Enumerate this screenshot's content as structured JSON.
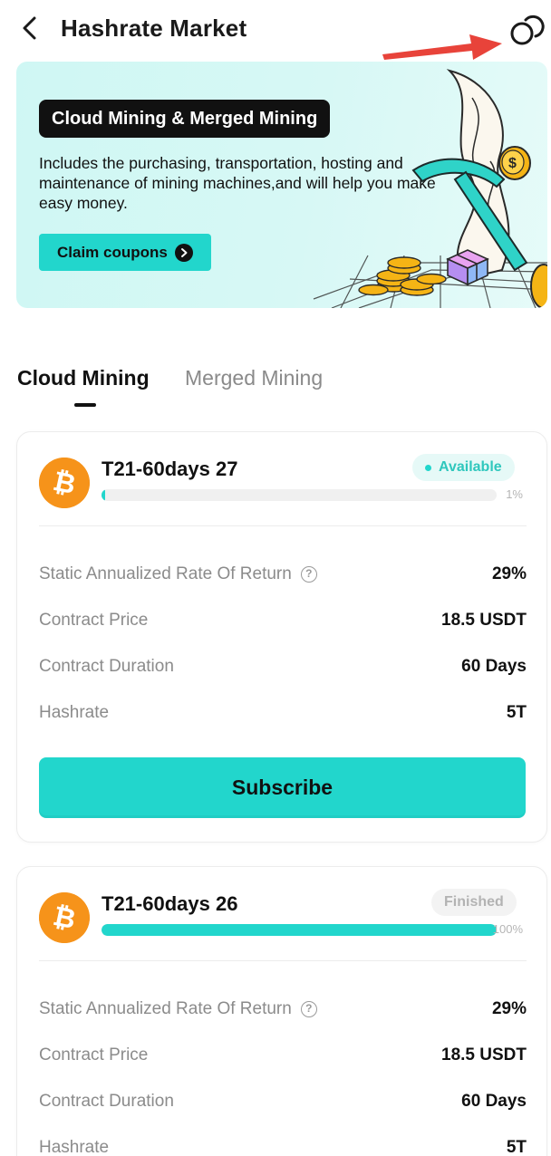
{
  "header": {
    "title": "Hashrate Market",
    "back_icon": "chevron-left-icon",
    "orders_icon": "linked-circles-icon"
  },
  "annotation": {
    "arrow_color": "#e8433a"
  },
  "banner": {
    "tag": "Cloud Mining & Merged Mining",
    "description": "Includes the purchasing, transportation, hosting and maintenance of mining machines,and will help you make easy money.",
    "claim_button": "Claim coupons",
    "background_color": "#d4f7f4"
  },
  "tabs": [
    {
      "label": "Cloud Mining",
      "active": true
    },
    {
      "label": "Merged Mining",
      "active": false
    }
  ],
  "colors": {
    "accent": "#22d6cc",
    "bitcoin": "#f6931a",
    "muted_text": "#8b8b8b"
  },
  "products": [
    {
      "title": "T21-60days 27",
      "status": "Available",
      "progress_percent": 1,
      "progress_label": "1%",
      "rows": [
        {
          "label": "Static Annualized Rate Of Return",
          "value": "29%",
          "help": true
        },
        {
          "label": "Contract Price",
          "value": "18.5 USDT",
          "help": false
        },
        {
          "label": "Contract Duration",
          "value": "60 Days",
          "help": false
        },
        {
          "label": "Hashrate",
          "value": "5T",
          "help": false
        }
      ],
      "button": "Subscribe"
    },
    {
      "title": "T21-60days 26",
      "status": "Finished",
      "progress_percent": 100,
      "progress_label": "100%",
      "rows": [
        {
          "label": "Static Annualized Rate Of Return",
          "value": "29%",
          "help": true
        },
        {
          "label": "Contract Price",
          "value": "18.5 USDT",
          "help": false
        },
        {
          "label": "Contract Duration",
          "value": "60 Days",
          "help": false
        },
        {
          "label": "Hashrate",
          "value": "5T",
          "help": false
        }
      ]
    }
  ]
}
